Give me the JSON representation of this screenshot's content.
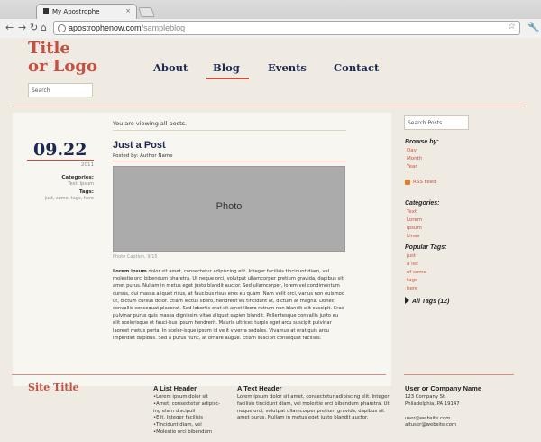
{
  "browser": {
    "tab_title": "My Apostrophe",
    "tab_close": "×",
    "url_host": "apostrophenow.com",
    "url_path": "/sampleblog"
  },
  "header": {
    "logo_line1": "Title",
    "logo_line2": "or Logo",
    "search_placeholder": "Search",
    "nav": [
      "About",
      "Blog",
      "Events",
      "Contact"
    ],
    "active_nav": "Blog"
  },
  "main": {
    "viewing_text": "You are viewing all posts.",
    "post": {
      "date": "09.22",
      "year": "2011",
      "categories_label": "Categories:",
      "categories_value": "Text, Ipsum",
      "tags_label": "Tags:",
      "tags_value": "just, some, tags, here",
      "title": "Just a Post",
      "author": "Posted by: Author Name",
      "photo_label": "Photo",
      "caption": "Photo Caption, 9/15",
      "body_lead": "Lorem ipsum",
      "body": "dolor sit amet, consectetur adipiscing elit. Integer facilisis tincidunt diam, vel molestie orci bibendum pharetra. Ut neque orci, volutpat ullamcorper pretium gravida, dapibus sit amet purus. Nullam in metus eget justo blandit auctor. Sed ullamcorper, lorem vel condimentum cursus, dui massa aliquet risus, at faucibus risus eros eu quam. Nam velit orci, varius non euismod ut, dictum cursus dolor. Etiam lectus libero, hendrerit eu tincidunt at, dictum at magna. Donec convallis consequat placerat. Sed lobortis erat sit amet libero rutrum non blandit elit suscipit. Cras pulvinar purus quis massa dignissim vitae aliquet sapien blandit. Pellentesque convallis justo eu elit scelerisque et fauci-bus ipsum hendrerit. Mauris ultrices turpis eget arcu suscipit pulvinar laoreet metus porta. In sceler-isque ipsum id velit viverra sodales. Vivamus at erat quis arcu imperdiet dapibus. Sed a purus nunc, at ornare augue. Etiam suscipit consequat facilisis."
    }
  },
  "sidebar": {
    "search_placeholder": "Search Posts",
    "browse_by_label": "Browse by:",
    "browse_by": [
      "Day",
      "Month",
      "Year"
    ],
    "rss_label": "RSS Feed",
    "categories_label": "Categories:",
    "categories": [
      "Text",
      "Lorem",
      "Ipsum",
      "Lines"
    ],
    "popular_tags_label": "Popular Tags:",
    "popular_tags": [
      "just",
      "a list",
      "of some",
      "tags",
      "here"
    ],
    "all_tags_label": "All Tags (12)"
  },
  "footer": {
    "site_title": "Site Title",
    "list_header": "A List Header",
    "list_items": [
      "•Lorem ipsum dolor sit",
      "•Amet, consectetur adipisc-",
      "ing elam discipuli",
      "•Elit. Integer facilisis",
      "•Tincidunt diam, vel",
      "•Molestie orci bibendum"
    ],
    "text_header": "A Text Header",
    "text_body": "Lorem ipsum dolor sit amet, consectetur adipiscing elit. Integer facilisis tincidunt diam, vel molestie orci bibendum pharetra. Ut neque orci, volutpat ullamcorper pretium gravida, dapibus sit amet purus. Nullam in metus eget justo blandit auctor.",
    "company_header": "User or Company Name",
    "address_line1": "123 Company St.",
    "address_line2": "Philadelphia, PA 19147",
    "email1": "user@website.com",
    "email2": "altuser@website.com"
  },
  "colors": {
    "accent": "#c5503f",
    "navy": "#1d2850",
    "background": "#efebe2"
  },
  "icons": [
    "back-arrow-icon",
    "forward-arrow-icon",
    "reload-icon",
    "home-icon",
    "globe-icon",
    "star-icon",
    "wrench-icon",
    "rss-icon",
    "triangle-right-icon"
  ]
}
